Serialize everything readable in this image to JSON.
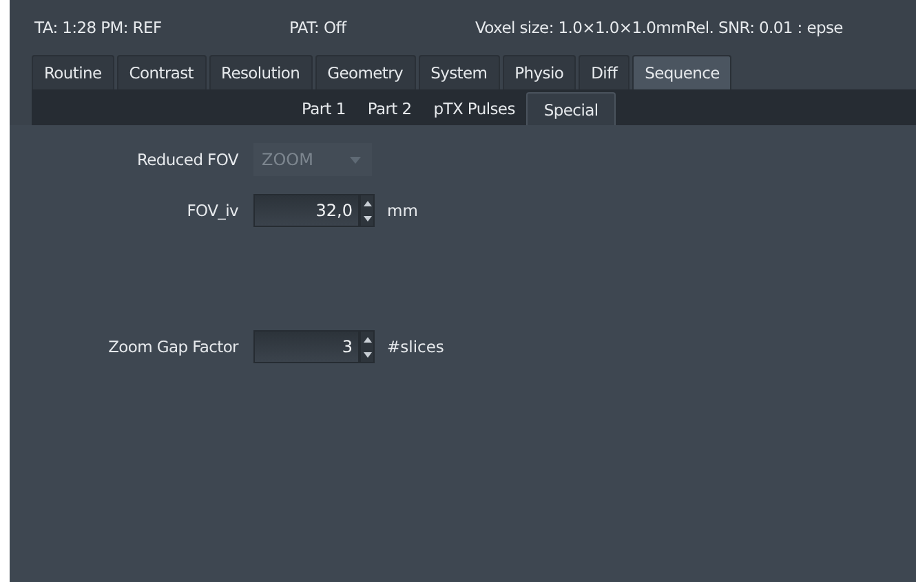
{
  "header": [
    "TA: 1:28 PM: REF",
    "PAT: Off",
    "Voxel size: 1.0×1.0×1.0mmRel. SNR: 0.01 : epse"
  ],
  "tabs": [
    {
      "label": "Routine",
      "selected": false
    },
    {
      "label": "Contrast",
      "selected": false
    },
    {
      "label": "Resolution",
      "selected": false
    },
    {
      "label": "Geometry",
      "selected": false
    },
    {
      "label": "System",
      "selected": false
    },
    {
      "label": "Physio",
      "selected": false
    },
    {
      "label": "Diff",
      "selected": false
    },
    {
      "label": "Sequence",
      "selected": true
    }
  ],
  "subtabs": [
    {
      "label": "Part 1",
      "selected": false
    },
    {
      "label": "Part 2",
      "selected": false
    },
    {
      "label": "pTX Pulses",
      "selected": false
    },
    {
      "label": "Special",
      "selected": true
    }
  ],
  "fields": [
    {
      "kind": "dropdown",
      "label": "Reduced FOV",
      "value": "ZOOM",
      "disabled": true
    },
    {
      "kind": "spinbox",
      "label": "FOV_iv",
      "value": "32,0",
      "unit": "mm",
      "disabled": false
    },
    {
      "kind": "spinbox",
      "label": "Zoom Gap Factor",
      "value": "3",
      "unit": "#slices",
      "disabled": false
    }
  ]
}
